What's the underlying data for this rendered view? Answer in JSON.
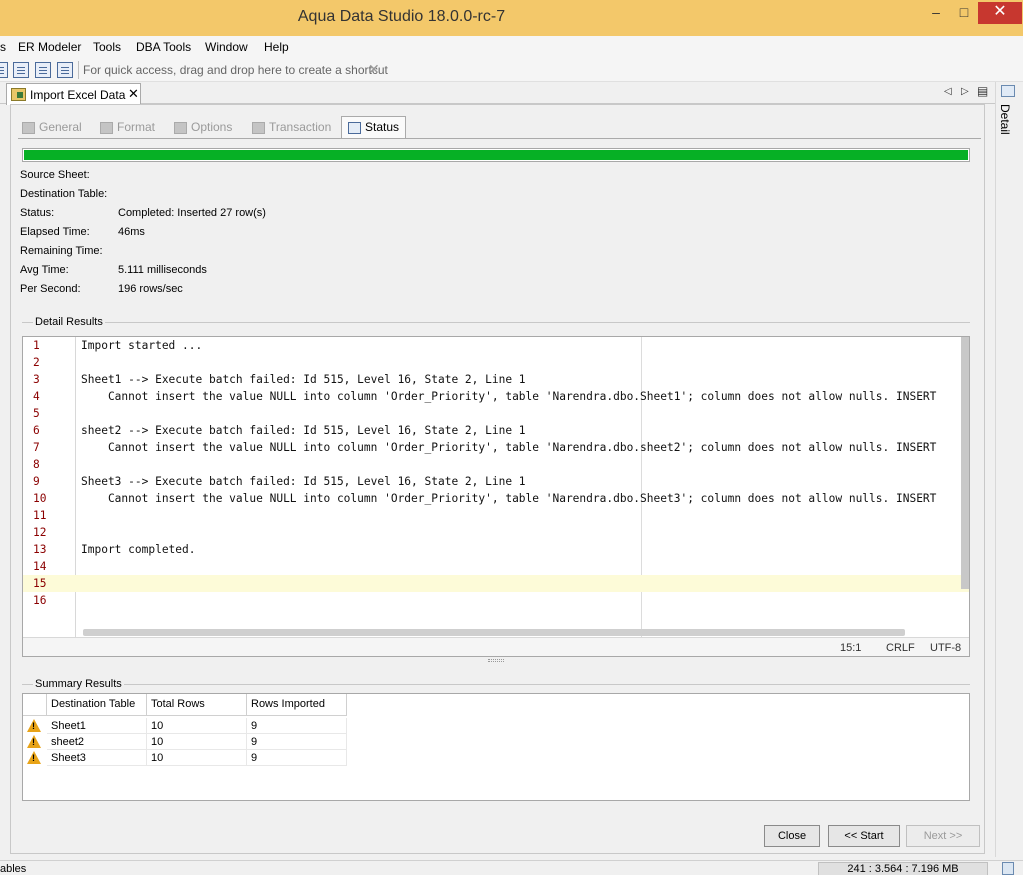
{
  "window": {
    "title": "Aqua Data Studio 18.0.0-rc-7",
    "min": "–",
    "max": "□",
    "close": "✕"
  },
  "menu": [
    "s",
    "ER Modeler",
    "Tools",
    "DBA Tools",
    "Window",
    "Help"
  ],
  "toolbar": {
    "hint": "For quick access, drag and drop here to create a shortcut",
    "hint_close": "✕"
  },
  "editor_tab": {
    "label": "Import Excel Data",
    "close": "✕"
  },
  "nav": {
    "left": "◁",
    "right": "▷",
    "list": "▤"
  },
  "detail_strip": {
    "label": "Detail"
  },
  "wizard_tabs": [
    {
      "label": "General",
      "active": false
    },
    {
      "label": "Format",
      "active": false
    },
    {
      "label": "Options",
      "active": false
    },
    {
      "label": "Transaction",
      "active": false
    },
    {
      "label": "Status",
      "active": true
    }
  ],
  "progress": {
    "fraction": 1.0,
    "color": "#06b025"
  },
  "status_info": [
    {
      "label": "Source Sheet:",
      "value": ""
    },
    {
      "label": "Destination Table:",
      "value": ""
    },
    {
      "label": "Status:",
      "value": "Completed: Inserted 27 row(s)"
    },
    {
      "label": "Elapsed Time:",
      "value": "46ms"
    },
    {
      "label": "Remaining Time:",
      "value": ""
    },
    {
      "label": "Avg Time:",
      "value": "5.111 milliseconds"
    },
    {
      "label": "Per Second:",
      "value": "196 rows/sec"
    }
  ],
  "detail_results": {
    "title": "Detail Results",
    "lines": [
      {
        "num": "1",
        "text": "Import started ..."
      },
      {
        "num": "2",
        "text": ""
      },
      {
        "num": "3",
        "text": "Sheet1 --> Execute batch failed: Id 515, Level 16, State 2, Line 1"
      },
      {
        "num": "4",
        "text": "    Cannot insert the value NULL into column 'Order_Priority', table 'Narendra.dbo.Sheet1'; column does not allow nulls. INSERT"
      },
      {
        "num": "5",
        "text": ""
      },
      {
        "num": "6",
        "text": "sheet2 --> Execute batch failed: Id 515, Level 16, State 2, Line 1"
      },
      {
        "num": "7",
        "text": "    Cannot insert the value NULL into column 'Order_Priority', table 'Narendra.dbo.sheet2'; column does not allow nulls. INSERT"
      },
      {
        "num": "8",
        "text": ""
      },
      {
        "num": "9",
        "text": "Sheet3 --> Execute batch failed: Id 515, Level 16, State 2, Line 1"
      },
      {
        "num": "10",
        "text": "    Cannot insert the value NULL into column 'Order_Priority', table 'Narendra.dbo.Sheet3'; column does not allow nulls. INSERT"
      },
      {
        "num": "11",
        "text": ""
      },
      {
        "num": "12",
        "text": ""
      },
      {
        "num": "13",
        "text": "Import completed."
      },
      {
        "num": "14",
        "text": ""
      },
      {
        "num": "15",
        "text": ""
      },
      {
        "num": "16",
        "text": ""
      }
    ],
    "current_line": 15,
    "status": {
      "position": "15:1",
      "line_ending": "CRLF",
      "encoding": "UTF-8"
    }
  },
  "summary_results": {
    "title": "Summary Results",
    "columns": [
      "Destination Table",
      "Total Rows",
      "Rows Imported"
    ],
    "rows": [
      {
        "table": "Sheet1",
        "total": "10",
        "imported": "9"
      },
      {
        "table": "sheet2",
        "total": "10",
        "imported": "9"
      },
      {
        "table": "Sheet3",
        "total": "10",
        "imported": "9"
      }
    ]
  },
  "buttons": {
    "close": "Close",
    "start": "<< Start",
    "next": "Next >>"
  },
  "statusbar": {
    "left": "ables",
    "memory": "241 : 3.564 : 7.196 MB"
  }
}
